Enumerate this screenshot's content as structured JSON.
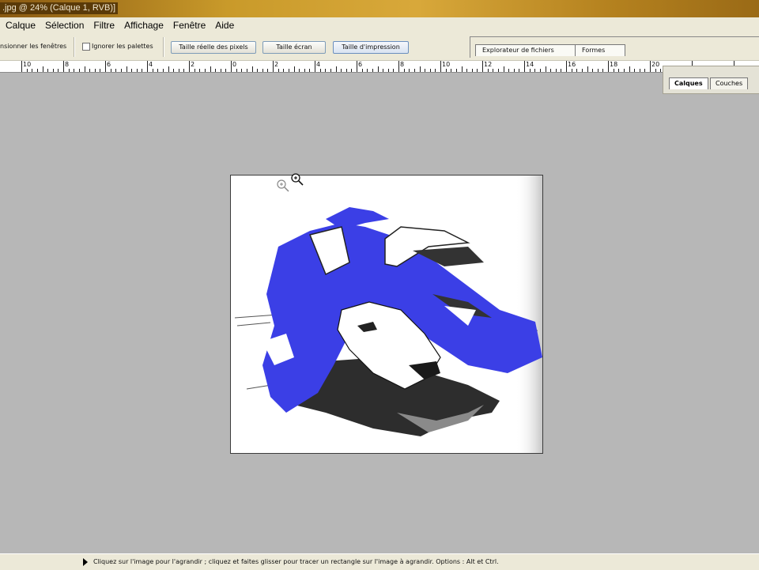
{
  "window": {
    "title": ".jpg @ 24% (Calque 1, RVB)]"
  },
  "menu": [
    "Calque",
    "Sélection",
    "Filtre",
    "Affichage",
    "Fenêtre",
    "Aide"
  ],
  "options": {
    "resize_windows_label": "nsionner les fenêtres",
    "ignore_palettes_label": "Ignorer les palettes",
    "ignore_palettes_checked": false,
    "actual_pixels_label": "Taille réelle des pixels",
    "fit_screen_label": "Taille écran",
    "print_size_label": "Taille d'impression"
  },
  "palette_well": {
    "tabs": [
      "Explorateur de fichiers",
      "Formes"
    ]
  },
  "ruler": {
    "labels": [
      "10",
      "8",
      "6",
      "4",
      "2",
      "0",
      "2",
      "4",
      "6",
      "8",
      "10",
      "12",
      "14",
      "16",
      "18",
      "20"
    ]
  },
  "layers_palette": {
    "tabs": [
      "Calques",
      "Couches"
    ],
    "selected": "Calques"
  },
  "document": {
    "zoom": "24%"
  },
  "status": {
    "text": "Cliquez sur l'image pour l'agrandir ; cliquez et faites glisser pour tracer un rectangle sur l'image à agrandir. Options : Alt et Ctrl."
  },
  "icons": {
    "zoom_cursor": "zoom-in-icon",
    "status_arrow": "play-arrow-icon"
  },
  "colors": {
    "title_bar": "#c99a2a",
    "workspace": "#b7b7b7",
    "artwork_blue": "#3b3fe6"
  }
}
